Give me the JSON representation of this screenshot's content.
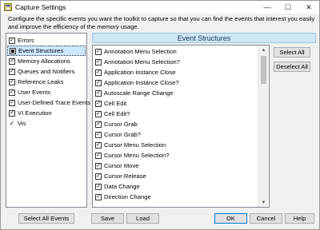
{
  "window": {
    "title": "Capture Settings",
    "controls": {
      "minimize": "—",
      "maximize": "☐",
      "close": "✕"
    }
  },
  "description": "Configure the specific events you want the toolkit to capture so that you can find the events that interest you easily and improve the efficiency of the memory usage.",
  "categories": [
    {
      "label": "Errors",
      "state": "checked"
    },
    {
      "label": "Event Structures",
      "state": "partial",
      "selected": true
    },
    {
      "label": "Memory Allocations",
      "state": "checked"
    },
    {
      "label": "Queues and Notifiers",
      "state": "checked"
    },
    {
      "label": "Reference Leaks",
      "state": "checked"
    },
    {
      "label": "User Events",
      "state": "checked"
    },
    {
      "label": "User-Defined Trace Events",
      "state": "checked"
    },
    {
      "label": "VI Execution",
      "state": "checked"
    },
    {
      "label": "Vis",
      "state": "checkmark-only"
    }
  ],
  "events_header": "Event Structures",
  "events": [
    "Annotation Menu Selection",
    "Annotation Menu Selection?",
    "Application Instance Close",
    "Application Instance Close?",
    "Autoscale Range Change",
    "Cell Edit",
    "Cell Edit?",
    "Cursor Grab",
    "Cursor Grab?",
    "Cursor Menu Selection",
    "Cursor Menu Selection?",
    "Cursor Move",
    "Cursor Release",
    "Data Change",
    "Direction Change"
  ],
  "buttons": {
    "select_all": "Select All",
    "deselect_all": "Deselect All",
    "select_all_events": "Select All Events",
    "save": "Save",
    "load": "Load",
    "ok": "OK",
    "cancel": "Cancel",
    "help": "Help"
  },
  "colors": {
    "accent": "#0078d7",
    "selection": "#cce8ff",
    "header_bg": "#cce6f4"
  }
}
